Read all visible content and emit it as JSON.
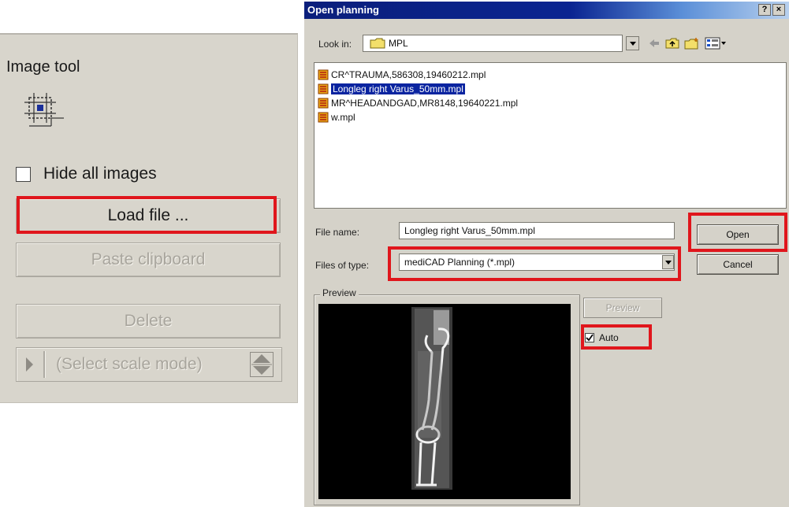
{
  "tool_panel": {
    "title": "Image tool",
    "hide_all_images": {
      "label": "Hide all images",
      "checked": false
    },
    "load_file_label": "Load file ...",
    "paste_clipboard_label": "Paste clipboard",
    "delete_label": "Delete",
    "scale_mode_label": "(Select scale mode)"
  },
  "dialog": {
    "title": "Open planning",
    "help_label": "?",
    "close_label": "×",
    "look_in_label": "Look in:",
    "look_in_value": "MPL",
    "files": [
      {
        "name": "CR^TRAUMA,586308,19460212.mpl",
        "selected": false
      },
      {
        "name": "Longleg right Varus_50mm.mpl",
        "selected": true
      },
      {
        "name": "MR^HEADANDGAD,MR8148,19640221.mpl",
        "selected": false
      },
      {
        "name": "w.mpl",
        "selected": false
      }
    ],
    "file_name_label": "File name:",
    "file_name_value": "Longleg right Varus_50mm.mpl",
    "files_of_type_label": "Files of type:",
    "files_of_type_value": "mediCAD Planning (*.mpl)",
    "open_label": "Open",
    "cancel_label": "Cancel",
    "preview_group_label": "Preview",
    "preview_button_label": "Preview",
    "auto_label": "Auto",
    "auto_checked": true
  },
  "colors": {
    "highlight": "#e0161c",
    "selection": "#0a24a0",
    "titlebar": "#0a2491"
  },
  "icons": [
    "image-tool-icon",
    "folder-icon",
    "back-arrow-icon",
    "up-folder-icon",
    "new-folder-icon",
    "view-menu-icon",
    "mpl-file-icon",
    "checkmark-icon",
    "spin-arrows-icon"
  ]
}
